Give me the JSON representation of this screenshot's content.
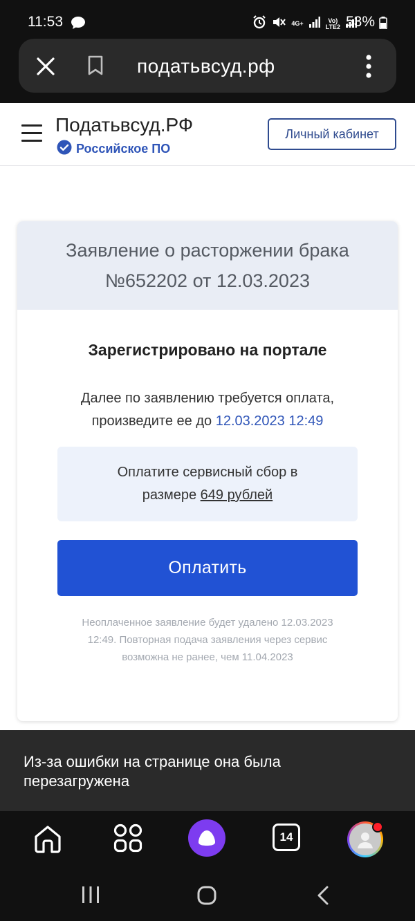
{
  "status_bar": {
    "time": "11:53",
    "network_4g": "4G+",
    "network_volte_top": "Vo)",
    "network_volte_bottom": "LTE2",
    "battery": "53%"
  },
  "browser": {
    "url": "податьвсуд.рф"
  },
  "header": {
    "brand": "Податьвсуд.РФ",
    "badge": "Российское ПО",
    "cabinet_button": "Личный кабинет"
  },
  "card": {
    "title_line1": "Заявление о расторжении брака",
    "title_line2": "№652202 от 12.03.2023",
    "status": "Зарегистрировано на портале",
    "desc_line1": "Далее по заявлению требуется оплата,",
    "desc_line2_prefix": "произведите ее до",
    "deadline": "12.03.2023 12:49",
    "fee_line1": "Оплатите сервисный сбор в",
    "fee_line2_prefix": "размере",
    "fee_amount": "649 рублей",
    "pay_button": "Оплатить",
    "note_line1": "Неоплаченное заявление будет удалено 12.03.2023",
    "note_line2": "12:49. Повторная подача заявления через сервис",
    "note_line3": "возможна не ранее, чем 11.04.2023"
  },
  "snackbar": {
    "line1": "Из-за ошибки на странице она была",
    "line2": "перезагружена"
  },
  "bottom_bar": {
    "tabs_count": "14"
  },
  "colors": {
    "accent_blue": "#2152d4",
    "link_blue": "#2f55b8",
    "alice_purple": "#7d3cf0",
    "notification_red": "#ff1f2a"
  }
}
